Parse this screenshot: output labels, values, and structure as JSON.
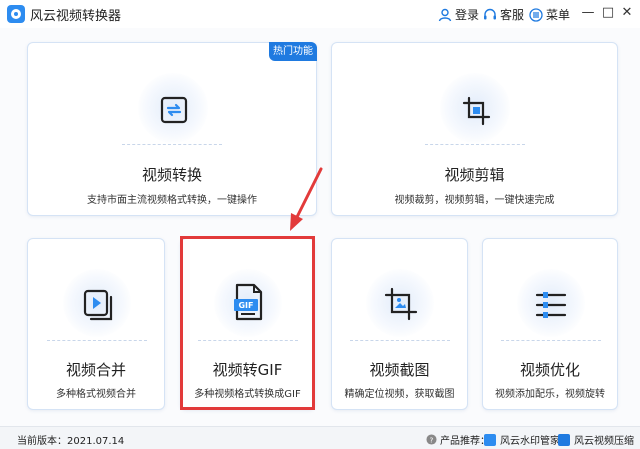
{
  "app": {
    "title": "风云视频转换器"
  },
  "titlebar": {
    "login": "登录",
    "service": "客服",
    "menu": "菜单",
    "minimize": "—",
    "maximize": "□",
    "close": "✕"
  },
  "cards": {
    "convert": {
      "title": "视频转换",
      "desc": "支持市面主流视频格式转换，一键操作",
      "badge": "热门功能",
      "icon": "refresh-icon"
    },
    "edit": {
      "title": "视频剪辑",
      "desc": "视频裁剪，视频剪辑，一键快速完成",
      "icon": "crop-icon"
    },
    "merge": {
      "title": "视频合并",
      "desc": "多种格式视频合并",
      "icon": "merge-icon"
    },
    "gif": {
      "title": "视频转GIF",
      "desc": "多种视频格式转换成GIF",
      "icon": "gif-file-icon",
      "icon_label": "GIF"
    },
    "screenshot": {
      "title": "视频截图",
      "desc": "精确定位视频，获取截图",
      "icon": "image-crop-icon"
    },
    "optimize": {
      "title": "视频优化",
      "desc": "视频添加配乐，视频旋转",
      "icon": "sliders-icon"
    }
  },
  "footer": {
    "version": "当前版本：2021.07.14",
    "recommend": "产品推荐：",
    "watermark": "风云水印管家",
    "compress": "风云视频压缩"
  },
  "colors": {
    "accent": "#1f7ae0",
    "highlight": "#e23a3a"
  }
}
